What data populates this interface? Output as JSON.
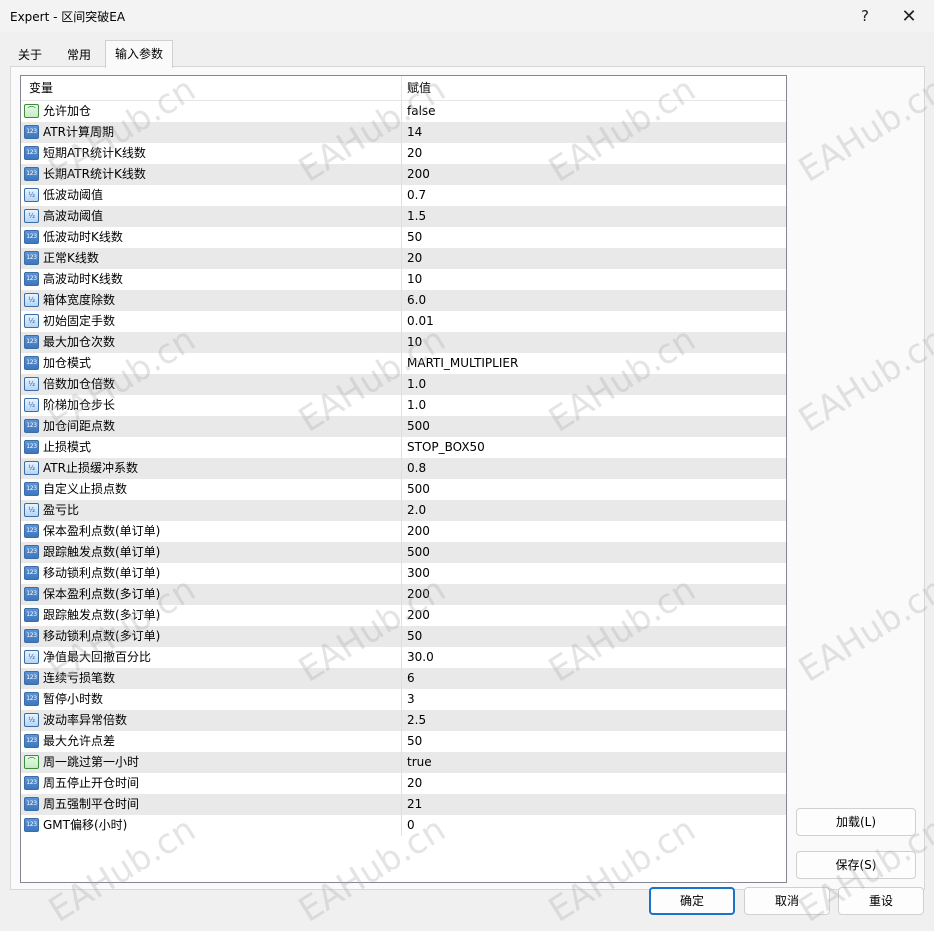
{
  "window": {
    "title": "Expert - 区间突破EA",
    "help_label": "?",
    "close_label": "✕"
  },
  "tabs": [
    {
      "label": "关于"
    },
    {
      "label": "常用"
    },
    {
      "label": "输入参数"
    }
  ],
  "grid": {
    "headers": {
      "variable": "变量",
      "value": "赋值"
    },
    "rows": [
      {
        "icon": "bool-icon",
        "icon_text": "⌒",
        "name": "允许加仓",
        "value": "false"
      },
      {
        "icon": "int-icon",
        "icon_text": "123",
        "name": "ATR计算周期",
        "value": "14"
      },
      {
        "icon": "int-icon",
        "icon_text": "123",
        "name": "短期ATR统计K线数",
        "value": "20"
      },
      {
        "icon": "int-icon",
        "icon_text": "123",
        "name": "长期ATR统计K线数",
        "value": "200"
      },
      {
        "icon": "double-icon",
        "icon_text": "½",
        "name": "低波动阈值",
        "value": "0.7"
      },
      {
        "icon": "double-icon",
        "icon_text": "½",
        "name": "高波动阈值",
        "value": "1.5"
      },
      {
        "icon": "int-icon",
        "icon_text": "123",
        "name": "低波动时K线数",
        "value": "50"
      },
      {
        "icon": "int-icon",
        "icon_text": "123",
        "name": "正常K线数",
        "value": "20"
      },
      {
        "icon": "int-icon",
        "icon_text": "123",
        "name": "高波动时K线数",
        "value": "10"
      },
      {
        "icon": "double-icon",
        "icon_text": "½",
        "name": "箱体宽度除数",
        "value": "6.0"
      },
      {
        "icon": "double-icon",
        "icon_text": "½",
        "name": "初始固定手数",
        "value": "0.01"
      },
      {
        "icon": "int-icon",
        "icon_text": "123",
        "name": "最大加仓次数",
        "value": "10"
      },
      {
        "icon": "int-icon",
        "icon_text": "123",
        "name": "加仓模式",
        "value": "MARTI_MULTIPLIER"
      },
      {
        "icon": "double-icon",
        "icon_text": "½",
        "name": "倍数加仓倍数",
        "value": "1.0"
      },
      {
        "icon": "double-icon",
        "icon_text": "½",
        "name": "阶梯加仓步长",
        "value": "1.0"
      },
      {
        "icon": "int-icon",
        "icon_text": "123",
        "name": "加仓间距点数",
        "value": "500"
      },
      {
        "icon": "int-icon",
        "icon_text": "123",
        "name": "止损模式",
        "value": "STOP_BOX50"
      },
      {
        "icon": "double-icon",
        "icon_text": "½",
        "name": "ATR止损缓冲系数",
        "value": "0.8"
      },
      {
        "icon": "int-icon",
        "icon_text": "123",
        "name": "自定义止损点数",
        "value": "500"
      },
      {
        "icon": "double-icon",
        "icon_text": "½",
        "name": "盈亏比",
        "value": "2.0"
      },
      {
        "icon": "int-icon",
        "icon_text": "123",
        "name": "保本盈利点数(单订单)",
        "value": "200"
      },
      {
        "icon": "int-icon",
        "icon_text": "123",
        "name": "跟踪触发点数(单订单)",
        "value": "500"
      },
      {
        "icon": "int-icon",
        "icon_text": "123",
        "name": "移动锁利点数(单订单)",
        "value": "300"
      },
      {
        "icon": "int-icon",
        "icon_text": "123",
        "name": "保本盈利点数(多订单)",
        "value": "200"
      },
      {
        "icon": "int-icon",
        "icon_text": "123",
        "name": "跟踪触发点数(多订单)",
        "value": "200"
      },
      {
        "icon": "int-icon",
        "icon_text": "123",
        "name": "移动锁利点数(多订单)",
        "value": "50"
      },
      {
        "icon": "double-icon",
        "icon_text": "½",
        "name": "净值最大回撤百分比",
        "value": "30.0"
      },
      {
        "icon": "int-icon",
        "icon_text": "123",
        "name": "连续亏损笔数",
        "value": "6"
      },
      {
        "icon": "int-icon",
        "icon_text": "123",
        "name": "暂停小时数",
        "value": "3"
      },
      {
        "icon": "double-icon",
        "icon_text": "½",
        "name": "波动率异常倍数",
        "value": "2.5"
      },
      {
        "icon": "int-icon",
        "icon_text": "123",
        "name": "最大允许点差",
        "value": "50"
      },
      {
        "icon": "bool-icon",
        "icon_text": "⌒",
        "name": "周一跳过第一小时",
        "value": "true"
      },
      {
        "icon": "int-icon",
        "icon_text": "123",
        "name": "周五停止开仓时间",
        "value": "20"
      },
      {
        "icon": "int-icon",
        "icon_text": "123",
        "name": "周五强制平仓时间",
        "value": "21"
      },
      {
        "icon": "int-icon",
        "icon_text": "123",
        "name": "GMT偏移(小时)",
        "value": "0"
      }
    ]
  },
  "buttons": {
    "load": "加载(L)",
    "save": "保存(S)",
    "ok": "确定",
    "cancel": "取消",
    "reset": "重设"
  },
  "watermark": {
    "text": "EAHub.cn"
  }
}
